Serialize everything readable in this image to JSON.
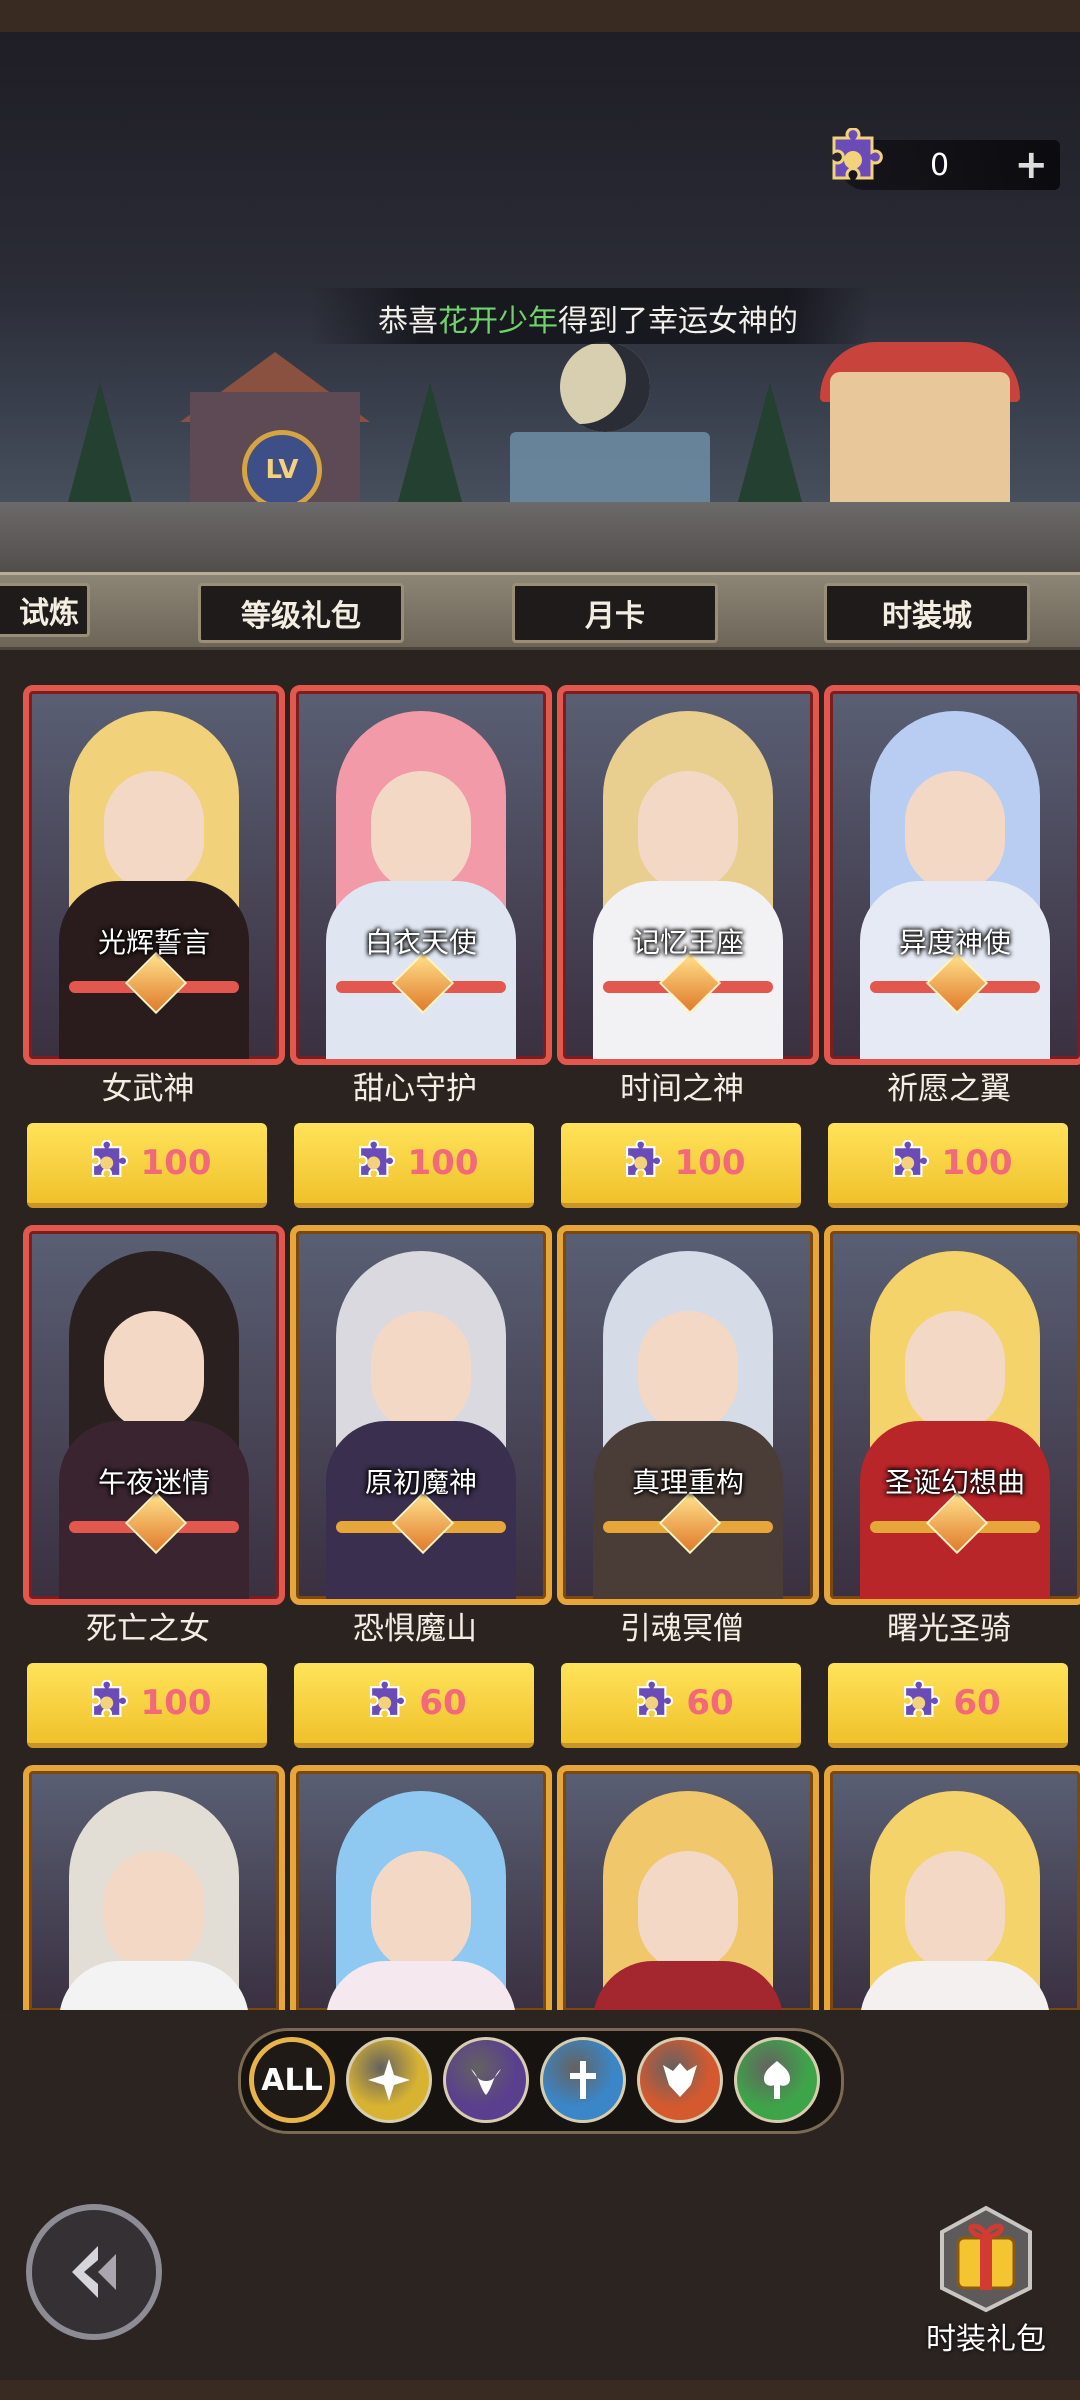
{
  "currency": {
    "value": "0",
    "plus": "+"
  },
  "marquee": {
    "prefix": "恭喜",
    "player": "花开少年",
    "suffix": "得到了幸运女神的"
  },
  "tabs": [
    {
      "label": "试炼"
    },
    {
      "label": "等级礼包"
    },
    {
      "label": "月卡"
    },
    {
      "label": "时装城"
    }
  ],
  "scene": {
    "lv_badge": "LV"
  },
  "cards": [
    {
      "skin": "光辉誓言",
      "name": "女武神",
      "price": "100",
      "frame": "red",
      "hair": "#f1d27a",
      "outfit": "#2a1c1c"
    },
    {
      "skin": "白衣天使",
      "name": "甜心守护",
      "price": "100",
      "frame": "red",
      "hair": "#f29aa8",
      "outfit": "#dfe6f2"
    },
    {
      "skin": "记忆王座",
      "name": "时间之神",
      "price": "100",
      "frame": "red",
      "hair": "#e8cf8f",
      "outfit": "#f2f2f5"
    },
    {
      "skin": "异度神使",
      "name": "祈愿之翼",
      "price": "100",
      "frame": "red",
      "hair": "#b9cdf2",
      "outfit": "#e6eaf5"
    },
    {
      "skin": "午夜迷情",
      "name": "死亡之女",
      "price": "100",
      "frame": "red",
      "hair": "#2a2020",
      "outfit": "#3a2430"
    },
    {
      "skin": "原初魔神",
      "name": "恐惧魔山",
      "price": "60",
      "frame": "gold",
      "hair": "#d9d9df",
      "outfit": "#3a2f4e"
    },
    {
      "skin": "真理重构",
      "name": "引魂冥僧",
      "price": "60",
      "frame": "gold",
      "hair": "#d6dbe8",
      "outfit": "#4a3c36"
    },
    {
      "skin": "圣诞幻想曲",
      "name": "曙光圣骑",
      "price": "60",
      "frame": "gold",
      "hair": "#f4d36a",
      "outfit": "#b8262a"
    },
    {
      "skin": "",
      "name": "",
      "price": "",
      "frame": "gold",
      "hair": "#e2ddd5",
      "outfit": "#f3f3f3"
    },
    {
      "skin": "",
      "name": "",
      "price": "",
      "frame": "gold",
      "hair": "#8fc9f2",
      "outfit": "#f5e8ef"
    },
    {
      "skin": "",
      "name": "",
      "price": "",
      "frame": "gold",
      "hair": "#f0c76a",
      "outfit": "#a4262e"
    },
    {
      "skin": "",
      "name": "",
      "price": "",
      "frame": "gold",
      "hair": "#f4d36a",
      "outfit": "#f5f0f0"
    }
  ],
  "filters": [
    {
      "label": "ALL",
      "icon": "all-icon",
      "color": "#1f1a16"
    },
    {
      "icon": "light-faction-icon",
      "color": "#d8b332"
    },
    {
      "icon": "dark-faction-icon",
      "color": "#5a3f8e"
    },
    {
      "icon": "sword-faction-icon",
      "color": "#3a86c7"
    },
    {
      "icon": "wolf-faction-icon",
      "color": "#d5592f"
    },
    {
      "icon": "tree-faction-icon",
      "color": "#3ea44a"
    }
  ],
  "bottom": {
    "gift_label": "时装礼包"
  }
}
